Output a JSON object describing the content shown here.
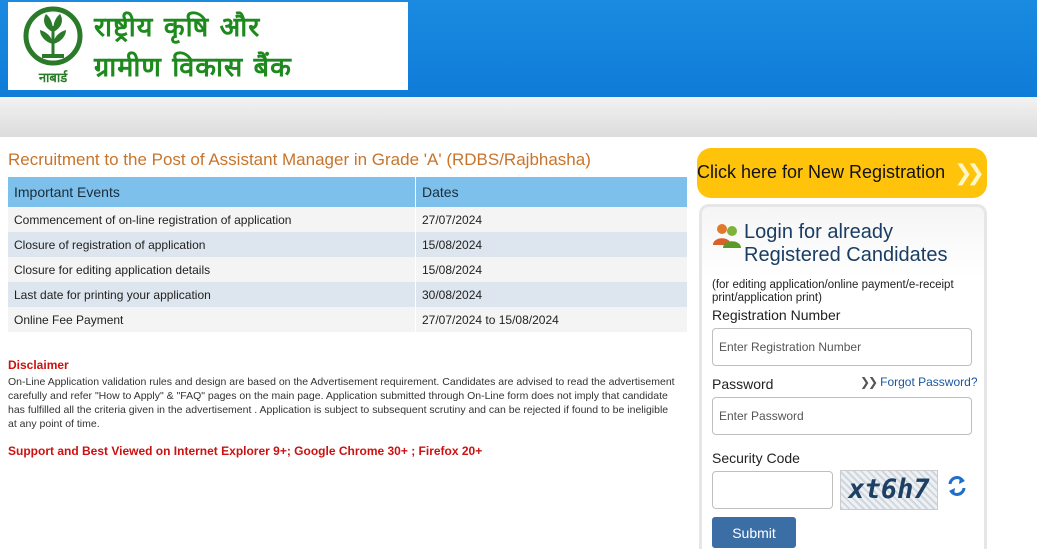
{
  "header": {
    "bank_name_line1": "राष्ट्रीय कृषि और",
    "bank_name_line2": "ग्रामीण विकास बैंक",
    "emblem_text": "नाबार्ड",
    "colors": {
      "band": "#1a8be0",
      "brand_green": "#1e8a1e"
    }
  },
  "main": {
    "title": "Recruitment to the Post of Assistant Manager in Grade 'A' (RDBS/Rajbhasha)",
    "table": {
      "headers": [
        "Important Events",
        "Dates"
      ],
      "rows": [
        [
          "Commencement of on-line registration of application",
          "27/07/2024"
        ],
        [
          "Closure of registration of application",
          "15/08/2024"
        ],
        [
          "Closure for editing application details",
          "15/08/2024"
        ],
        [
          "Last date for printing your application",
          "30/08/2024"
        ],
        [
          "Online Fee Payment",
          "27/07/2024 to 15/08/2024"
        ]
      ]
    },
    "disclaimer_heading": "Disclaimer",
    "disclaimer_text": "On-Line Application validation rules and design are based on the Advertisement requirement. Candidates are advised to read the advertisement carefully and refer \"How to Apply\" & \"FAQ\" pages on the main page. Application submitted through On-Line form does not imply that candidate has fulfilled all the criteria given in the advertisement . Application is subject to subsequent scrutiny and can be rejected if found to be ineligible at any point of time.",
    "support_text": "Support and Best Viewed on Internet Explorer 9+; Google Chrome 30+ ; Firefox 20+"
  },
  "sidebar": {
    "new_registration_label": "Click here for New Registration",
    "login_title_line1": "Login for already",
    "login_title_line2": "Registered Candidates",
    "login_note": "(for editing application/online payment/e-receipt print/application print)",
    "registration_label": "Registration Number",
    "registration_placeholder": "Enter Registration Number",
    "password_label": "Password",
    "password_placeholder": "Enter Password",
    "forgot_password": "Forgot Password?",
    "security_code_label": "Security Code",
    "captcha_text": "xt6h7",
    "submit_label": "Submit",
    "colors": {
      "new_reg": "#ffc30b",
      "submit": "#3a6ea5"
    }
  }
}
